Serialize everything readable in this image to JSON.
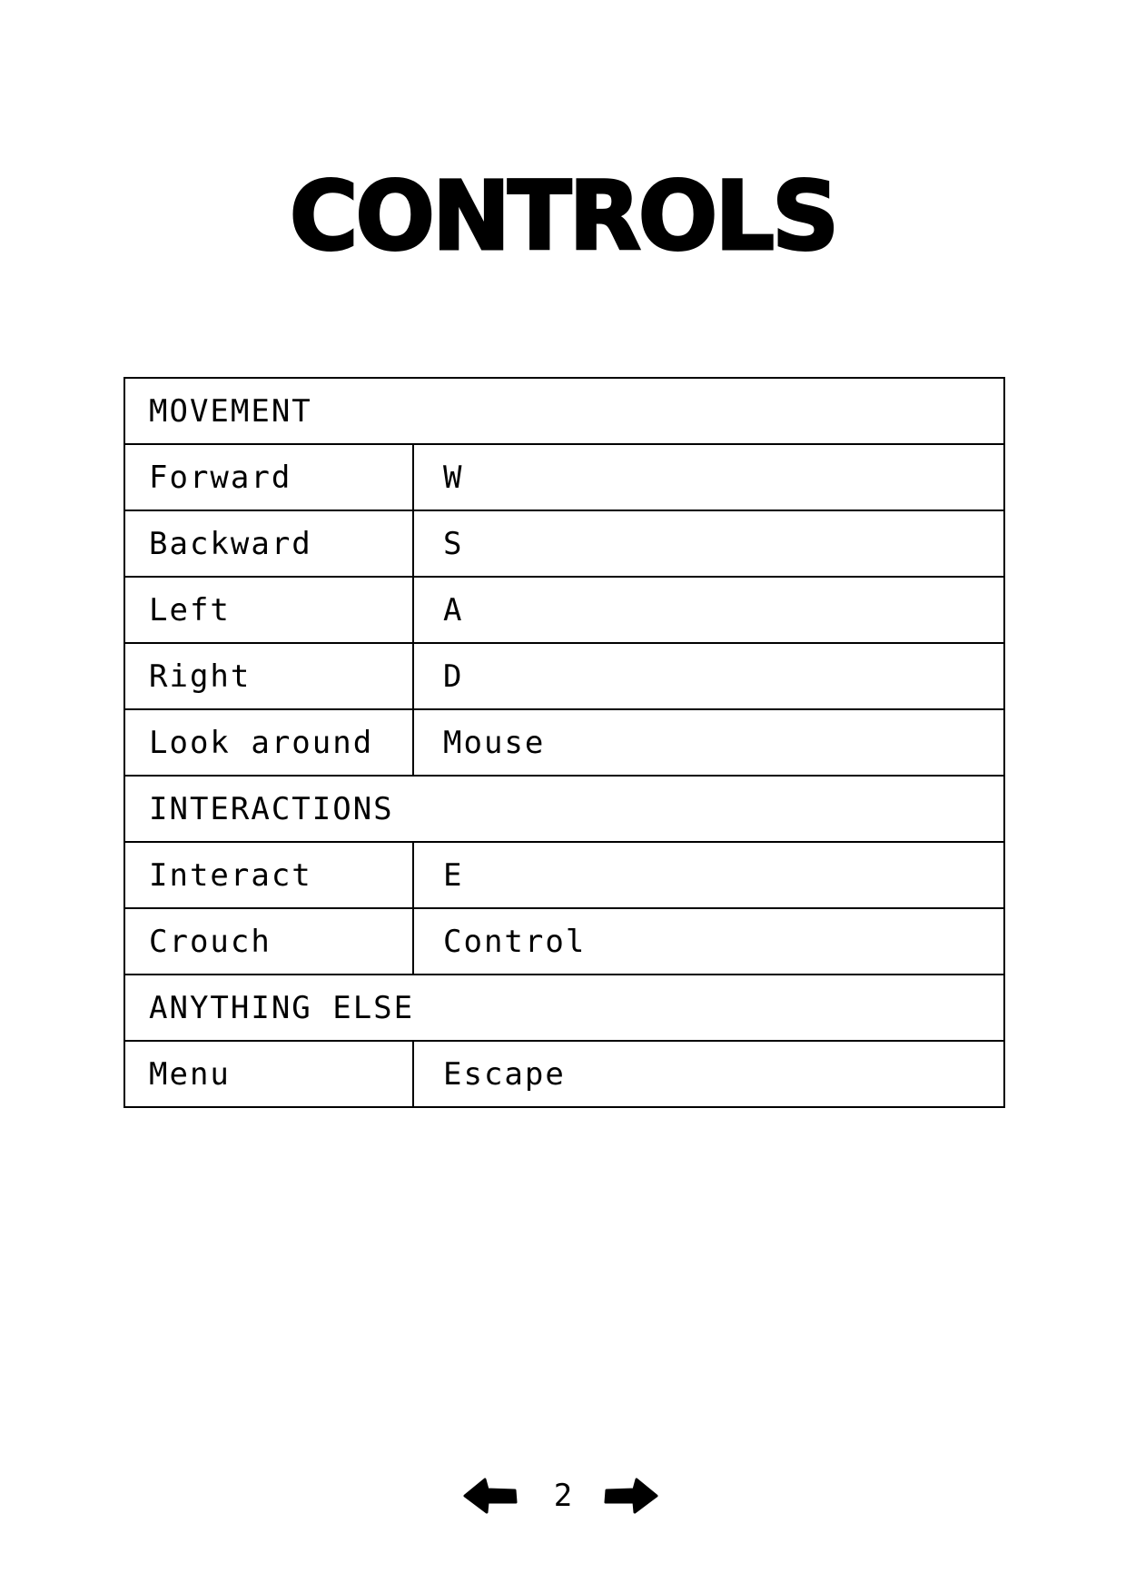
{
  "title": "CONTROLS",
  "sections": [
    {
      "header": "MOVEMENT",
      "rows": [
        {
          "action": "Forward",
          "key": "W"
        },
        {
          "action": "Backward",
          "key": "S"
        },
        {
          "action": "Left",
          "key": "A"
        },
        {
          "action": "Right",
          "key": "D"
        },
        {
          "action": "Look around",
          "key": "Mouse"
        }
      ]
    },
    {
      "header": "INTERACTIONS",
      "rows": [
        {
          "action": "Interact",
          "key": "E"
        },
        {
          "action": "Crouch",
          "key": "Control"
        }
      ]
    },
    {
      "header": "ANYTHING ELSE",
      "rows": [
        {
          "action": "Menu",
          "key": "Escape"
        }
      ]
    }
  ],
  "pager": {
    "page_number": "2",
    "prev_icon": "arrow-left-icon",
    "next_icon": "arrow-right-icon"
  }
}
